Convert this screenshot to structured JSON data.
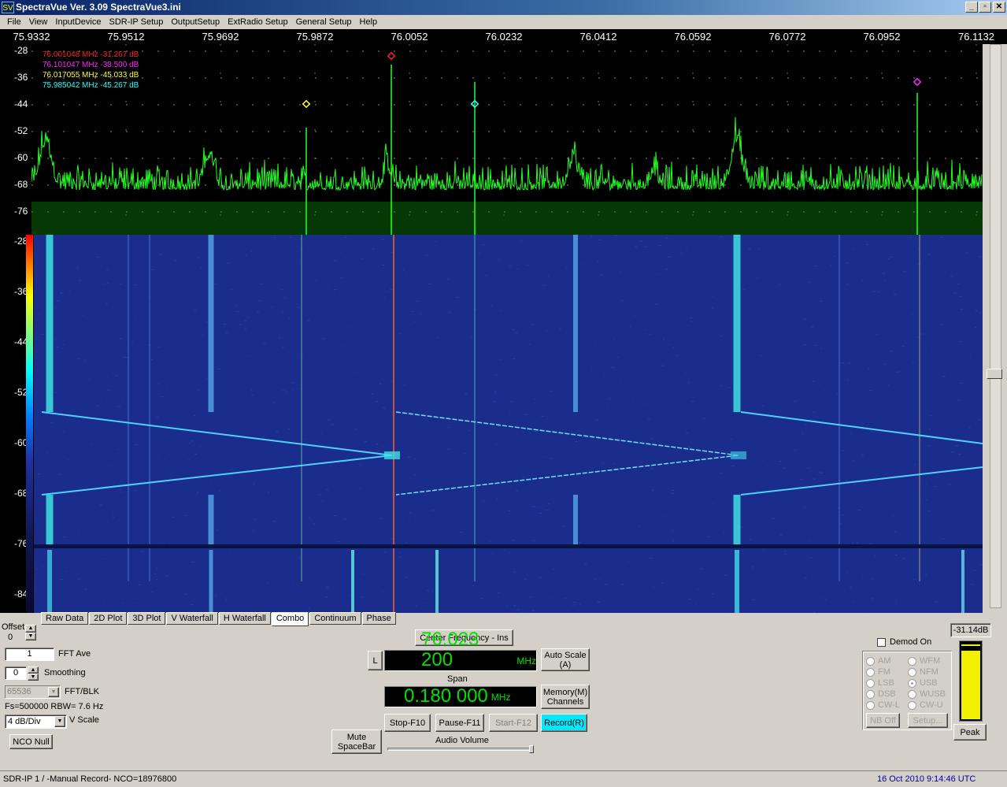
{
  "window": {
    "title": "SpectraVue Ver. 3.09   SpectraVue3.ini",
    "icon_text": "SV",
    "minimize": "_",
    "restore": "▫",
    "close": "✕"
  },
  "menu": [
    "File",
    "View",
    "InputDevice",
    "SDR-IP Setup",
    "OutputSetup",
    "ExtRadio Setup",
    "General Setup",
    "Help"
  ],
  "freq_ticks": [
    "75.9332",
    "75.9512",
    "75.9692",
    "75.9872",
    "76.0052",
    "76.0232",
    "76.0412",
    "76.0592",
    "76.0772",
    "76.0952",
    "76.1132"
  ],
  "spectrum": {
    "y_ticks": [
      "-28",
      "-36",
      "-44",
      "-52",
      "-60",
      "-68",
      "-76"
    ],
    "markers": [
      {
        "text": "76.001048 MHz  -31.267  dB",
        "color": "#ff2020"
      },
      {
        "text": "76.101047 MHz  -38.500  dB",
        "color": "#ff20ff"
      },
      {
        "text": "76.017055 MHz  -45.033  dB",
        "color": "#ffff20"
      },
      {
        "text": "75.985042 MHz  -45.267  dB",
        "color": "#20ffff"
      }
    ]
  },
  "waterfall": {
    "y_ticks": [
      "-28",
      "-36",
      "-44",
      "-52",
      "-60",
      "-68",
      "-76",
      "-84"
    ]
  },
  "tabs": [
    "Raw Data",
    "2D Plot",
    "3D Plot",
    "V Waterfall",
    "H Waterfall",
    "Combo",
    "Continuum",
    "Phase"
  ],
  "active_tab": "Combo",
  "left_panel": {
    "offset_label": "Offset",
    "offset_value": "0",
    "fft_ave_value": "1",
    "fft_ave_label": "FFT Ave",
    "smoothing_value": "0",
    "smoothing_label": "Smoothing",
    "fft_blk_value": "65536",
    "fft_blk_label": "FFT/BLK",
    "fs_info": "Fs=500000 RBW= 7.6 Hz",
    "vscale_value": "4 dB/Div",
    "vscale_label": "V Scale",
    "nco_null": "NCO Null"
  },
  "center": {
    "center_freq_btn": "Center Frequency - Ins",
    "l_btn": "L",
    "center_freq": "76.023 200",
    "freq_unit": "MHz",
    "auto_scale": "Auto Scale\n(A)",
    "span_label": "Span",
    "span_value": "0.180 000",
    "span_unit": "MHz",
    "memory": "Memory(M)\nChannels",
    "stop": "Stop-F10",
    "pause": "Pause-F11",
    "start": "Start-F12",
    "record": "Record(R)",
    "mute": "Mute\nSpaceBar",
    "audio_volume": "Audio Volume"
  },
  "demod": {
    "label": "Demod On",
    "modes_left": [
      "AM",
      "FM",
      "LSB",
      "DSB",
      "CW-L"
    ],
    "modes_right": [
      "WFM",
      "NFM",
      "USB",
      "WUSB",
      "CW-U"
    ],
    "selected": "USB",
    "nb_off": "NB Off",
    "setup": "Setup..."
  },
  "meter": {
    "readout": "-31.14dB",
    "peak": "Peak",
    "level_fraction": 0.9
  },
  "status": {
    "left": "SDR-IP 1  / -Manual Record-   NCO=18976800",
    "right": "16 Oct 2010  9:14:46 UTC"
  }
}
